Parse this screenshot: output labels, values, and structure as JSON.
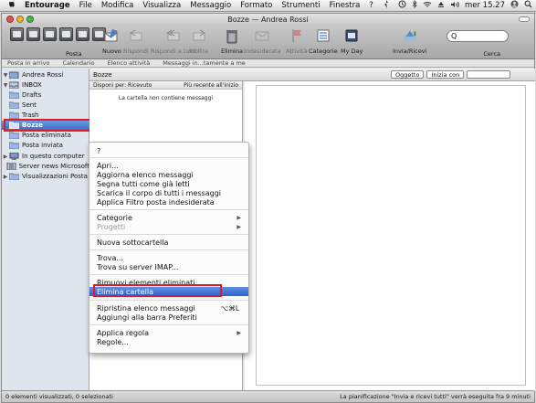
{
  "menubar": {
    "app": "Entourage",
    "items": [
      "File",
      "Modifica",
      "Visualizza",
      "Messaggio",
      "Formato",
      "Strumenti",
      "Finestra"
    ],
    "help": "?",
    "clock": "mer 15.27"
  },
  "window": {
    "title": "Bozze — Andrea Rossi"
  },
  "toolbar": {
    "posta": "Posta",
    "nuovo": "Nuovo",
    "rispondi": "Rispondi",
    "rispondi_tutti": "Rispondi a tutti",
    "inoltra": "Inoltra",
    "elimina": "Elimina",
    "indesiderata": "Indesiderata",
    "attivita": "Attività",
    "categorie": "Categorie",
    "my_day": "My Day",
    "invia_ricevi": "Invia/Ricevi",
    "cerca": "Cerca",
    "search_value": "Q"
  },
  "tabs": [
    "Posta in arrivo",
    "Calendario",
    "Elenco attività",
    "Messaggi in...tamente a me"
  ],
  "sidebar": {
    "account": "Andrea Rossi",
    "inbox": "INBOX",
    "items": [
      "Drafts",
      "Sent",
      "Trash",
      "Bozze",
      "Posta eliminata",
      "Posta inviata"
    ],
    "groups": [
      "In questo computer",
      "Server news Microsoft",
      "Visualizzazioni Posta"
    ]
  },
  "folderbar": {
    "name": "Bozze",
    "filter_field": "Oggetto",
    "filter_mode": "Inizia con"
  },
  "msglist": {
    "sort_by": "Disponi per: Ricevuto",
    "sort_order": "Più recente all'inizio",
    "empty": "La cartella non contiene messaggi"
  },
  "context_menu": {
    "items": [
      {
        "label": "?"
      },
      {
        "label": "Apri..."
      },
      {
        "label": "Aggiorna elenco messaggi"
      },
      {
        "label": "Segna tutti come già letti"
      },
      {
        "label": "Scarica il corpo di tutti i messaggi"
      },
      {
        "label": "Applica Filtro posta indesiderata"
      },
      {
        "label": "Categorie"
      },
      {
        "label": "Progetti"
      },
      {
        "label": "Nuova sottocartella"
      },
      {
        "label": "Trova..."
      },
      {
        "label": "Trova su server IMAP..."
      },
      {
        "label": "Rimuovi elementi eliminati"
      },
      {
        "label": "Elimina cartella"
      },
      {
        "label": "Ripristina elenco messaggi",
        "shortcut": "⌥⌘L"
      },
      {
        "label": "Aggiungi alla barra Preferiti"
      },
      {
        "label": "Applica regola"
      },
      {
        "label": "Regole..."
      }
    ]
  },
  "status": {
    "left": "0 elementi visualizzati, 0 selezionati",
    "right": "La pianificazione \"Invia e ricevi tutti\" verrà eseguita fra 9 minuti"
  },
  "colors": {
    "selection": "#3a6fce",
    "highlight_box": "#e01b24"
  }
}
